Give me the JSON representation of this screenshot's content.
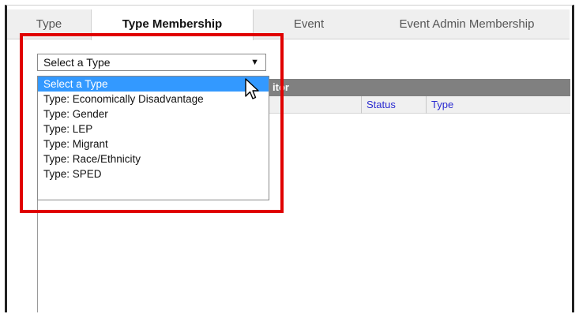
{
  "tabs": [
    {
      "label": "Type",
      "active": false
    },
    {
      "label": "Type Membership",
      "active": true
    },
    {
      "label": "Event",
      "active": false
    },
    {
      "label": "Event Admin Membership",
      "active": false
    }
  ],
  "select": {
    "value": "Select a Type",
    "arrow_icon": "triangle-down-icon"
  },
  "dropdown": {
    "options": [
      {
        "label": "Select a Type",
        "selected": true
      },
      {
        "label": "Type: Economically Disadvantage",
        "selected": false
      },
      {
        "label": "Type: Gender",
        "selected": false
      },
      {
        "label": "Type: LEP",
        "selected": false
      },
      {
        "label": "Type: Migrant",
        "selected": false
      },
      {
        "label": "Type: Race/Ethnicity",
        "selected": false
      },
      {
        "label": "Type: SPED",
        "selected": false
      }
    ]
  },
  "panel": {
    "header_partial": "itor",
    "columns": [
      "Status",
      "Type"
    ]
  },
  "colors": {
    "highlight": "#e00000",
    "selected_option": "#3399ff",
    "panel_header": "#808080",
    "column_link": "#2a2ad0"
  },
  "cursor_icon": "pointer-arrow-icon"
}
